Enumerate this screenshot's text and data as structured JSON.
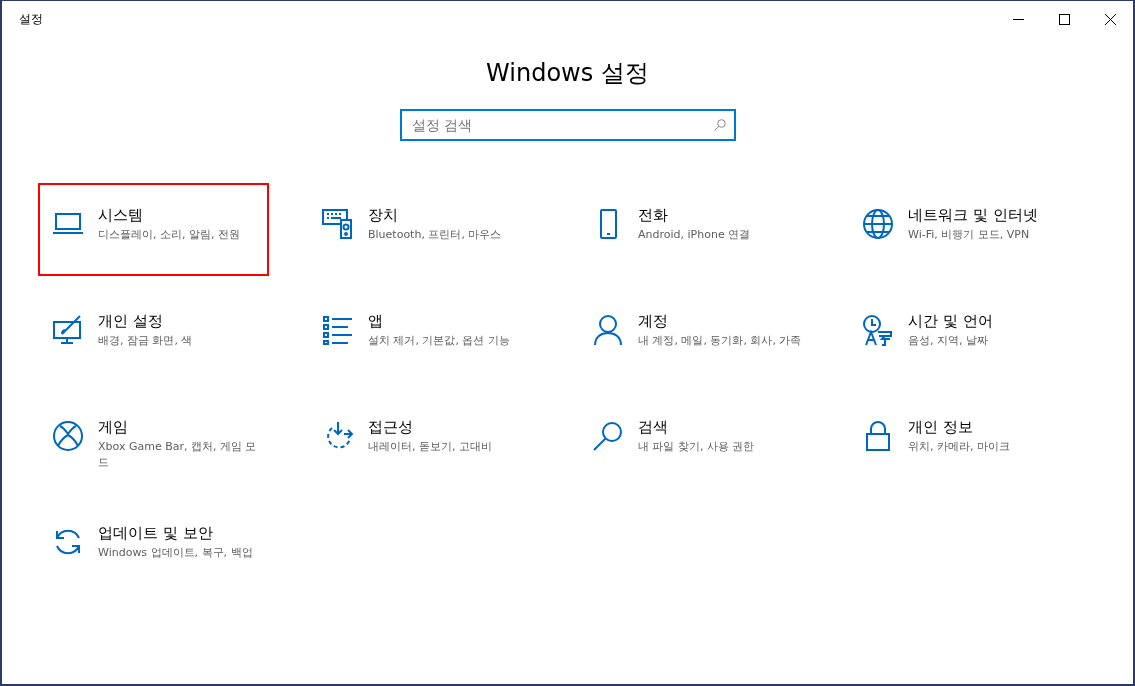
{
  "window": {
    "title": "설정"
  },
  "heading": "Windows 설정",
  "search": {
    "placeholder": "설정 검색"
  },
  "tiles": [
    {
      "title": "시스템",
      "description": "디스플레이, 소리, 알림, 전원",
      "highlighted": true
    },
    {
      "title": "장치",
      "description": "Bluetooth, 프린터, 마우스",
      "highlighted": false
    },
    {
      "title": "전화",
      "description": "Android, iPhone 연결",
      "highlighted": false
    },
    {
      "title": "네트워크 및 인터넷",
      "description": "Wi-Fi, 비행기 모드, VPN",
      "highlighted": false
    },
    {
      "title": "개인 설정",
      "description": "배경, 잠금 화면, 색",
      "highlighted": false
    },
    {
      "title": "앱",
      "description": "설치 제거, 기본값, 옵션 기능",
      "highlighted": false
    },
    {
      "title": "계정",
      "description": "내 계정, 메일, 동기화, 회사, 가족",
      "highlighted": false
    },
    {
      "title": "시간 및 언어",
      "description": "음성, 지역, 날짜",
      "highlighted": false
    },
    {
      "title": "게임",
      "description": "Xbox Game Bar, 캡처, 게임 모드",
      "highlighted": false
    },
    {
      "title": "접근성",
      "description": "내레이터, 돋보기, 고대비",
      "highlighted": false
    },
    {
      "title": "검색",
      "description": "내 파일 찾기, 사용 권한",
      "highlighted": false
    },
    {
      "title": "개인 정보",
      "description": "위치, 카메라, 마이크",
      "highlighted": false
    },
    {
      "title": "업데이트 및 보안",
      "description": "Windows 업데이트, 복구, 백업",
      "highlighted": false
    }
  ]
}
